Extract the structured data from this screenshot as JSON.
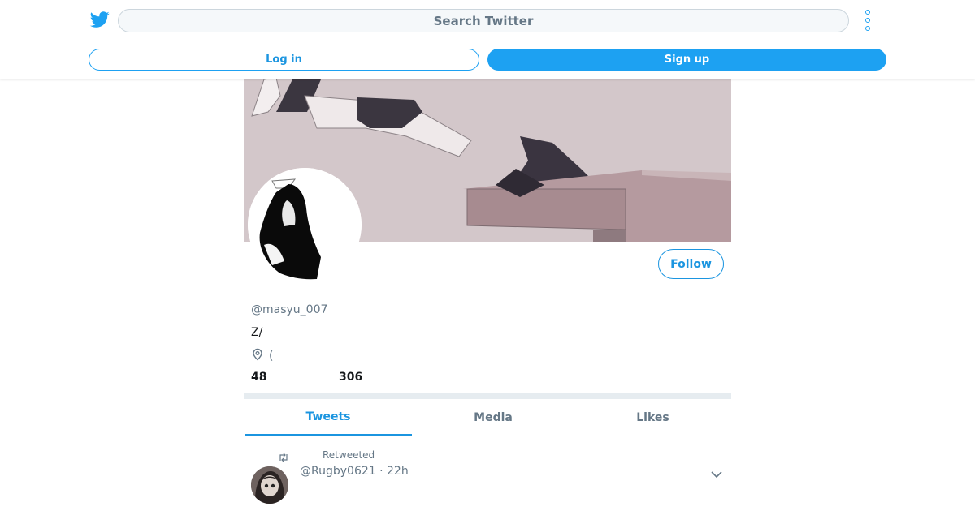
{
  "header": {
    "search_placeholder": "Search Twitter",
    "login_label": "Log in",
    "signup_label": "Sign up",
    "brand_color": "#1da1f2"
  },
  "profile": {
    "handle": "@masyu_007",
    "bio": "Z/",
    "location": "(",
    "stat_1_value": "48",
    "stat_2_value": "306",
    "follow_label": "Follow"
  },
  "tabs": [
    {
      "label": "Tweets",
      "active": true
    },
    {
      "label": "Media",
      "active": false
    },
    {
      "label": "Likes",
      "active": false
    }
  ],
  "tweet": {
    "retweet_label": "Retweeted",
    "meta": "@Rugby0621 · 22h"
  },
  "icons": [
    "twitter-bird-icon",
    "more-options-icon",
    "location-pin-icon",
    "retweet-icon",
    "chevron-down-icon"
  ]
}
